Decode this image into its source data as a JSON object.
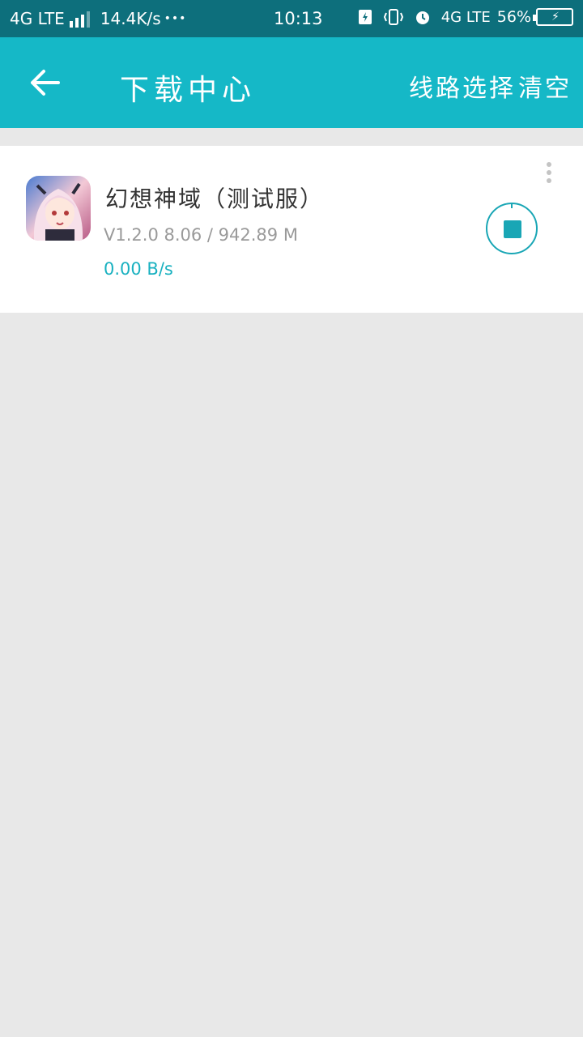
{
  "status_bar": {
    "network": "4G LTE",
    "speed": "14.4K/s",
    "dots": "•••",
    "time": "10:13",
    "network2": "4G LTE",
    "battery_percent": "56%"
  },
  "toolbar": {
    "title": "下载中心",
    "route_label": "线路选择",
    "clear_label": "清空"
  },
  "download_item": {
    "name": "幻想神域（测试服）",
    "meta": "V1.2.0  8.06 / 942.89 M",
    "speed": "0.00 B/s"
  },
  "colors": {
    "status_bar_bg": "#0d6f7c",
    "toolbar_bg": "#15b8c7",
    "accent": "#19a6b5",
    "page_bg": "#e8e8e8"
  }
}
